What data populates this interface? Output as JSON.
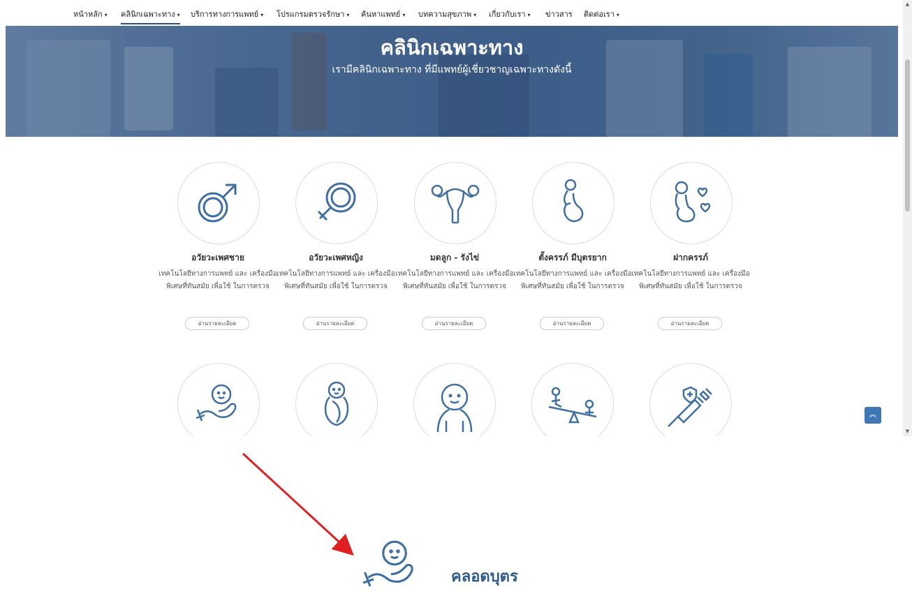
{
  "nav": {
    "items": [
      {
        "label": "หน้าหลัก",
        "chevron": true
      },
      {
        "label": "คลินิกเฉพาะทาง",
        "chevron": true
      },
      {
        "label": "บริการทางการแพทย์",
        "chevron": true
      },
      {
        "label": "โปรแกรมตรวจรักษา",
        "chevron": true
      },
      {
        "label": "ค้นหาแพทย์",
        "chevron": true
      },
      {
        "label": "บทความสุขภาพ",
        "chevron": true
      },
      {
        "label": "เกี่ยวกับเรา",
        "chevron": true
      },
      {
        "label": "ข่าวสาร",
        "chevron": false
      },
      {
        "label": "ติดต่อเรา",
        "chevron": true
      }
    ],
    "active_index": 1
  },
  "hero": {
    "title": "คลินิกเฉพาะทาง",
    "subtitle": "เรามีคลินิกเฉพาะทาง ที่มีแพทย์ผู้เชี่ยวชาญเฉพาะทางดังนี้"
  },
  "cards_row1": [
    {
      "title": "อวัยวะเพศชาย",
      "desc": "เทคโนโลยีทางการแพทย์ และ เครื่องมือพิเศษที่ทันสมัย เพื่อใช้ ในการตรวจ",
      "button": "อ่านรายละเอียด",
      "icon": "male-symbol-icon"
    },
    {
      "title": "อวัยวะเพศหญิง",
      "desc": "เทคโนโลยีทางการแพทย์ และ เครื่องมือพิเศษที่ทันสมัย เพื่อใช้ ในการตรวจ",
      "button": "อ่านรายละเอียด",
      "icon": "female-symbol-icon"
    },
    {
      "title": "มดลูก - รังไข่",
      "desc": "เทคโนโลยีทางการแพทย์ และ เครื่องมือพิเศษที่ทันสมัย เพื่อใช้ ในการตรวจ",
      "button": "อ่านรายละเอียด",
      "icon": "uterus-icon"
    },
    {
      "title": "ตั้งครรภ์ มีบุตรยาก",
      "desc": "เทคโนโลยีทางการแพทย์ และ เครื่องมือพิเศษที่ทันสมัย เพื่อใช้ ในการตรวจ",
      "button": "อ่านรายละเอียด",
      "icon": "pregnant-woman-icon"
    },
    {
      "title": "ฝากครรภ์",
      "desc": "เทคโนโลยีทางการแพทย์ และ เครื่องมือพิเศษที่ทันสมัย เพื่อใช้ ในการตรวจ",
      "button": "อ่านรายละเอียด",
      "icon": "pregnant-heart-icon"
    }
  ],
  "cards_row2": [
    {
      "icon": "baby-in-hand-icon"
    },
    {
      "icon": "swaddled-baby-icon"
    },
    {
      "icon": "child-face-icon"
    },
    {
      "icon": "seesaw-icon"
    },
    {
      "icon": "vaccine-syringe-icon"
    }
  ],
  "zoom_callout": {
    "label": "คลอดบุตร",
    "icon": "baby-in-hand-icon"
  },
  "colors": {
    "accent": "#2d5a8c",
    "icon_stroke": "#3f6ea0",
    "arrow": "#e02020",
    "to_top": "#3f76b4"
  },
  "to_top_icon": "double-chevron-up-icon"
}
